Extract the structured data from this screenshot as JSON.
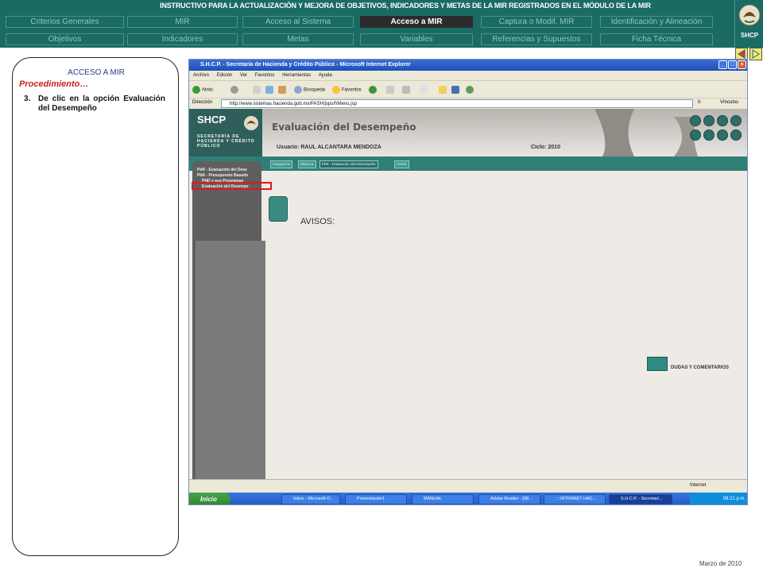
{
  "header": {
    "title": "INSTRUCTIVO PARA  LA ACTUALIZACIÓN Y MEJORA DE OBJETIVOS, INDICADORES Y METAS DE LA MIR REGISTRADOS EN EL MÓDULO DE LA MIR",
    "tabs_row1": [
      "Criterios Generales",
      "MIR",
      "Acceso al Sistema",
      "Acceso a MIR",
      "Captura o Modif. MIR",
      "Identificación y Alineación"
    ],
    "tabs_row2": [
      "Objetivos",
      "Indicadores",
      "Metas",
      "Variables",
      "Referencias y Supuestos",
      "Ficha Técnica"
    ],
    "active_tab": "Acceso a MIR",
    "logo_label": "SHCP"
  },
  "left_panel": {
    "heading": "ACCESO A MIR",
    "subheading": "Procedimiento…",
    "step_number": "3.",
    "step_text": "De clic en la opción Evaluación del Desempeño"
  },
  "browser": {
    "window_title": "S.H.C.P. - Secretaría de Hacienda y Crédito Público - Microsoft Internet Explorer",
    "menu": [
      "Archivo",
      "Edición",
      "Ver",
      "Favoritos",
      "Herramientas",
      "Ayuda"
    ],
    "toolbar": {
      "back": "Atrás",
      "search": "Búsqueda",
      "favorites": "Favoritos"
    },
    "address_label": "Dirección",
    "address": "http://www.sistemas.hacienda.gob.mx/PASH/jsps/frMenu.jsp",
    "go": "Ir",
    "links": "Vínculos",
    "status": "Internet"
  },
  "site": {
    "logo": "SHCP",
    "secretaria": "SECRETARÍA DE HACIENDA Y CRÉDITO PÚBLICO",
    "title": "Evaluación del Desempeño",
    "user": "Usuario: RAUL ALCANTARA MENDOZA",
    "cycle": "Ciclo: 2010",
    "tabs": [
      "Integración",
      "Bitácora",
      "PbR - Evaluación del Desempeño",
      "Cerrar"
    ],
    "nav": [
      "PbR - Evaluación del Dese",
      "PbR - Presupuesto Basado",
      "PND y sus Programas",
      "Evaluación del Desempe"
    ],
    "avisos": "AVISOS:",
    "dudas": "DUDAS Y COMENTARIOS"
  },
  "taskbar": {
    "start": "Inicio",
    "tasks": [
      "Inbox - Microsoft O...",
      "Presentación1",
      "MANUAL",
      "Adobe Reader - [08...",
      "::::INTRANET HAC...",
      "S.H.C.P. - Secretarí..."
    ],
    "time": "08:21 p.m."
  },
  "footer": {
    "date": "Marzo de 2010"
  }
}
